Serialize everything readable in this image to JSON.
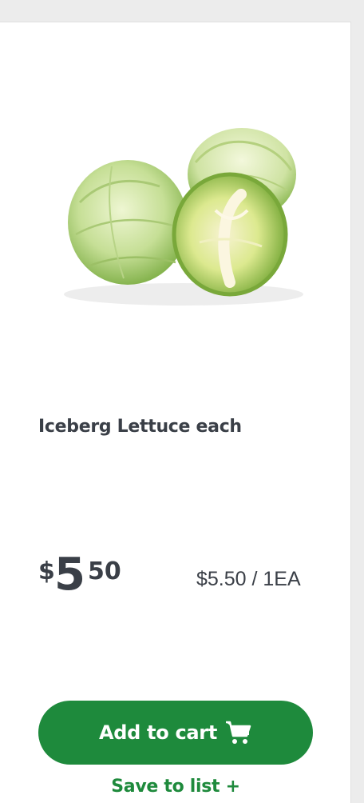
{
  "product": {
    "image": "iceberg-lettuce-image",
    "title": "Iceberg Lettuce each",
    "price": {
      "symbol": "$",
      "dollars": "5",
      "cents": "50"
    },
    "unit_price": "$5.50 / 1EA"
  },
  "actions": {
    "add_to_cart_label": "Add to cart",
    "add_to_cart_icon": "cart-icon",
    "save_to_list_label": "Save to list +"
  },
  "colors": {
    "brand_green": "#1e8a3c",
    "text_dark": "#3a3f47",
    "background": "#ececec",
    "card": "#ffffff"
  }
}
